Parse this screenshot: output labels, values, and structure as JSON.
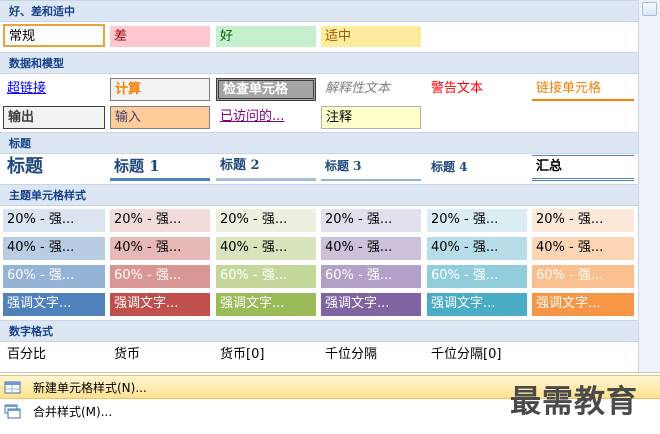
{
  "sections": {
    "good_bad_neutral": "好、差和适中",
    "data_model": "数据和模型",
    "titles": "标题",
    "theme_styles": "主题单元格样式",
    "number_format": "数字格式"
  },
  "good_bad_neutral": {
    "normal": "常规",
    "bad": "差",
    "good": "好",
    "neutral": "适中"
  },
  "data_model": {
    "hyperlink": "超链接",
    "calculation": "计算",
    "check_cell": "检查单元格",
    "explanatory": "解释性文本",
    "warning": "警告文本",
    "linked_cell": "链接单元格",
    "output": "输出",
    "input": "输入",
    "followed_hyperlink": "已访问的...",
    "note": "注释"
  },
  "titles": {
    "title": "标题",
    "heading1": "标题 1",
    "heading2": "标题 2",
    "heading3": "标题 3",
    "heading4": "标题 4",
    "total": "汇总"
  },
  "theme_styles": {
    "row20": "20% - 强...",
    "row40": "40% - 强...",
    "row60": "60% - 强...",
    "accent": "强调文字..."
  },
  "number_format": {
    "percent": "百分比",
    "currency": "货币",
    "currency0": "货币[0]",
    "comma": "千位分隔",
    "comma0": "千位分隔[0]"
  },
  "menu": {
    "new_style": "新建单元格样式(N)...",
    "merge_styles": "合并样式(M)..."
  },
  "watermark": "最需教育",
  "colors": {
    "header_bg": "#dde7f3",
    "bad_bg": "#ffc7ce",
    "bad_fg": "#9c0006",
    "good_bg": "#c6efce",
    "good_fg": "#006100",
    "neutral_bg": "#ffeb9c",
    "neutral_fg": "#9c5700",
    "accents": [
      "#4f81bd",
      "#c0504d",
      "#9bbb59",
      "#8064a2",
      "#4bacc6",
      "#f79646"
    ]
  }
}
